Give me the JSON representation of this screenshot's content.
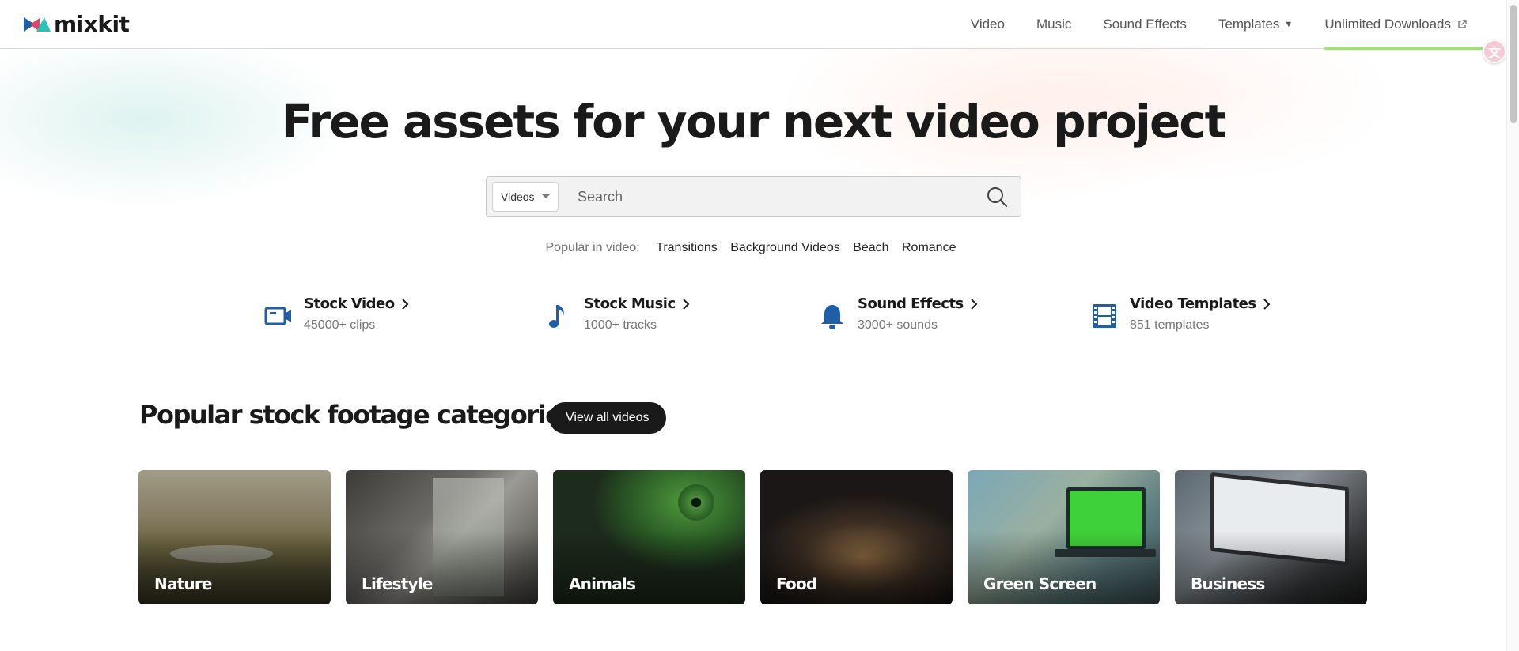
{
  "header": {
    "logo_text": "mixkit",
    "nav": [
      {
        "label": "Video"
      },
      {
        "label": "Music"
      },
      {
        "label": "Sound Effects"
      },
      {
        "label": "Templates"
      },
      {
        "label": "Unlimited Downloads"
      }
    ]
  },
  "hero": {
    "title": "Free assets for your next video project",
    "search": {
      "selected_type": "Videos",
      "placeholder": "Search",
      "value": ""
    },
    "popular": {
      "label": "Popular in video:",
      "tags": [
        "Transitions",
        "Background Videos",
        "Beach",
        "Romance"
      ]
    }
  },
  "asset_types": [
    {
      "title": "Stock Video",
      "subtitle": "45000+ clips",
      "icon": "video-camera-icon"
    },
    {
      "title": "Stock Music",
      "subtitle": "1000+ tracks",
      "icon": "music-note-icon"
    },
    {
      "title": "Sound Effects",
      "subtitle": "3000+ sounds",
      "icon": "bell-icon"
    },
    {
      "title": "Video Templates",
      "subtitle": "851 templates",
      "icon": "film-strip-icon"
    }
  ],
  "categories": {
    "heading": "Popular stock footage categories",
    "view_all_label": "View all videos",
    "items": [
      {
        "label": "Nature"
      },
      {
        "label": "Lifestyle"
      },
      {
        "label": "Animals"
      },
      {
        "label": "Food"
      },
      {
        "label": "Green Screen"
      },
      {
        "label": "Business"
      }
    ]
  },
  "colors": {
    "icon_blue": "#1f5fa8",
    "accent_green": "#9fe07a",
    "button_dark": "#1a1a1a"
  }
}
